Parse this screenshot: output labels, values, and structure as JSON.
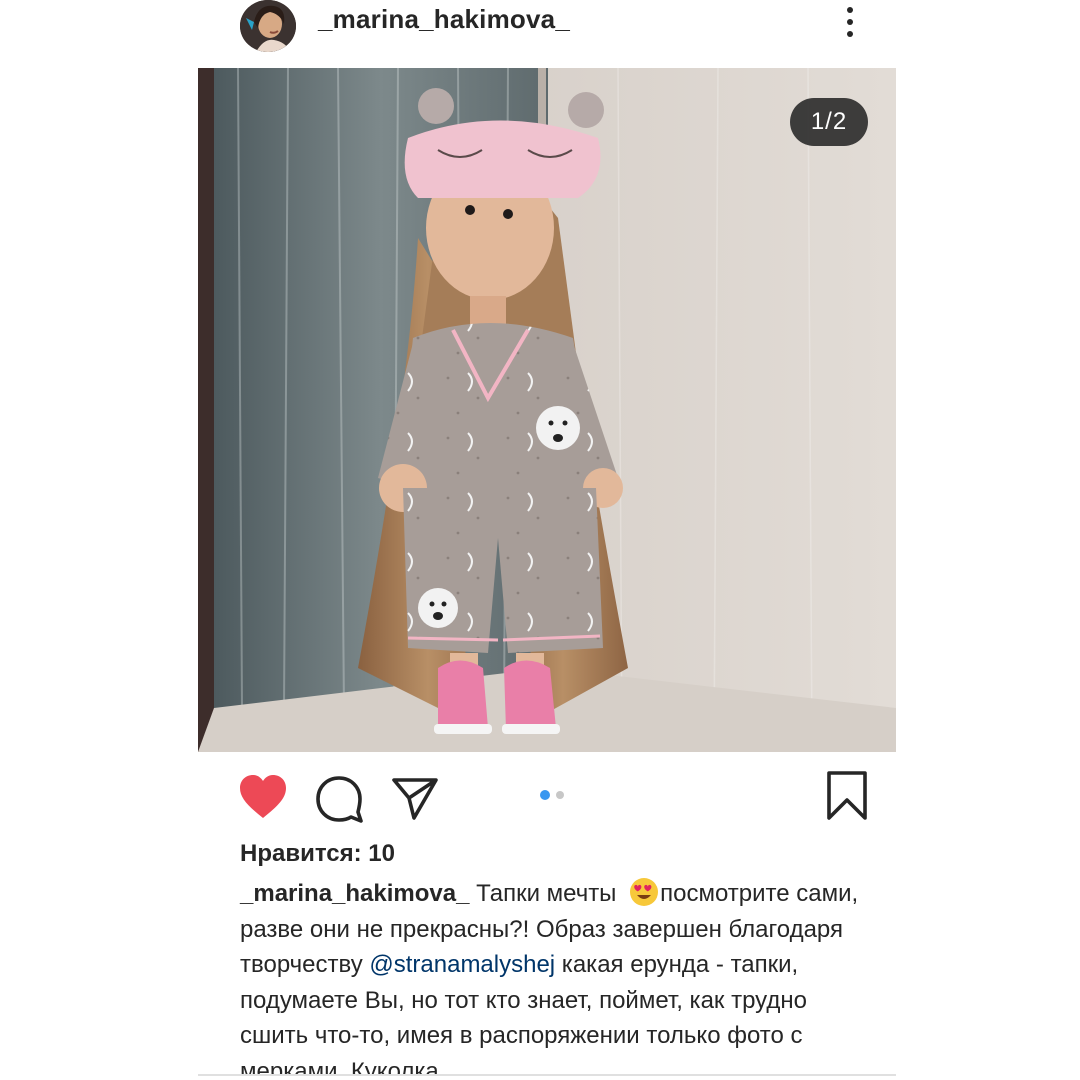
{
  "header": {
    "username": "_marina_hakimova_",
    "more_icon": "more-vertical-icon",
    "avatar_icon": "profile-avatar"
  },
  "post": {
    "counter": "1/2",
    "carousel": {
      "current": 1,
      "total": 2
    }
  },
  "actions": {
    "like_icon": "heart-filled-icon",
    "comment_icon": "comment-bubble-icon",
    "share_icon": "paper-plane-icon",
    "bookmark_icon": "bookmark-icon",
    "liked": true,
    "colors": {
      "like": "#ed4956",
      "dot_active": "#3897f0",
      "dot_inactive": "#c7c7c7",
      "mention": "#003569"
    }
  },
  "likes": {
    "text": "Нравится: 10"
  },
  "caption": {
    "username": "_marina_hakimova_",
    "part1": " Тапки мечты ",
    "emoji": "smiling-face-with-heart-eyes",
    "part2": "посмотрите сами, разве они не прекрасны?! Образ завершен благодаря творчеству ",
    "mention": "@stranamalyshej",
    "part3": "  какая ерунда - тапки, подумаете Вы, но тот кто знает, поймет, как трудно сшить что-то, имея в распоряжении только фото с мерками. Куколка"
  }
}
